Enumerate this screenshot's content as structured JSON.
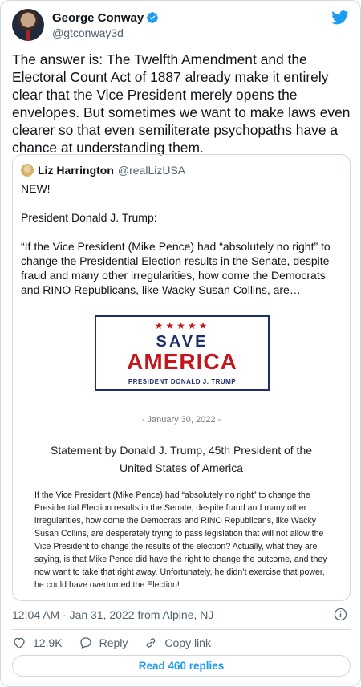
{
  "tweet": {
    "author": {
      "name": "George Conway",
      "handle": "@gtconway3d"
    },
    "text": "The answer is:  The Twelfth Amendment and the Electoral Count Act of 1887 already make it entirely clear that the Vice President merely opens the envelopes.  But sometimes we want to make laws even clearer so that even semiliterate psychopaths have a chance at understanding them.",
    "timestamp": "12:04 AM · Jan 31, 2022 from Alpine, NJ",
    "likes": "12.9K",
    "reply_label": "Reply",
    "copy_link_label": "Copy link",
    "read_replies_label": "Read 460 replies"
  },
  "quote": {
    "author": {
      "name": "Liz Harrington",
      "handle": "@realLizUSA"
    },
    "text": "NEW!\n\nPresident Donald J. Trump:\n\n“If the Vice President (Mike Pence) had “absolutely no right” to change the Presidential Election results in the Senate, despite fraud and many other irregularities, how come the Democrats and RINO Republicans, like Wacky Susan Collins, are…",
    "image": {
      "stars": "★★★★★",
      "save": "SAVE",
      "america": "AMERICA",
      "president": "PRESIDENT DONALD J. TRUMP",
      "date": "- January 30, 2022 -",
      "title": "Statement by Donald J. Trump, 45th President of the United States of America",
      "body": "If the Vice President (Mike Pence) had “absolutely no right” to change the Presidential Election results in the Senate, despite fraud and many other irregularities, how come the Democrats and RINO Republicans, like Wacky Susan Collins, are desperately trying to pass legislation that will not allow the Vice President to change the results of the election? Actually, what they are saying, is that Mike Pence did have the right to change the outcome, and they now want to take that right away. Unfortunately, he didn’t exercise that power, he could have overturned the Election!"
    }
  },
  "icons": {
    "verified": "verified-badge-icon",
    "brand": "twitter-bird-icon",
    "info": "info-icon",
    "like": "heart-icon",
    "reply": "speech-bubble-icon",
    "copy": "link-icon"
  },
  "colors": {
    "accent": "#1d9bf0",
    "muted": "#536471",
    "border": "#cfd9de",
    "logo_red": "#c4161c",
    "logo_navy": "#1c2f6b"
  }
}
